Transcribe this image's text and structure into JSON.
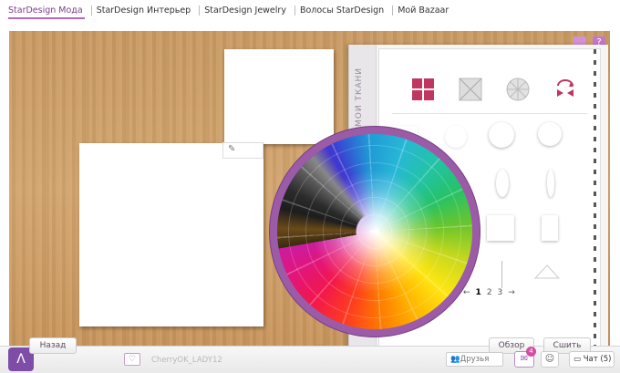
{
  "nav": {
    "tabs": [
      {
        "label": "StarDesign Мода",
        "active": true
      },
      {
        "label": "StarDesign Интерьер",
        "active": false
      },
      {
        "label": "StarDesign Jewelry",
        "active": false
      },
      {
        "label": "Волосы StarDesign",
        "active": false
      },
      {
        "label": "Мой Bazaar",
        "active": false
      }
    ]
  },
  "panel": {
    "side_label": "МОИ ТКАНИ",
    "pager": {
      "prev": "←",
      "pages": [
        "1",
        "2",
        "3"
      ],
      "current": "1",
      "next": "→"
    }
  },
  "bottom": {
    "logo": "Λ",
    "back_label": "Назад",
    "review_label": "Обзор",
    "sew_label": "Сшить",
    "username": "CherryOK_LADY12",
    "friends_label": "Друзья",
    "msg_badge": "4",
    "chat_label": "Чат (5)"
  },
  "colors": {
    "accent": "#9b5ba7",
    "brand": "#7e4da8",
    "cat_icon": "#c0365f"
  }
}
